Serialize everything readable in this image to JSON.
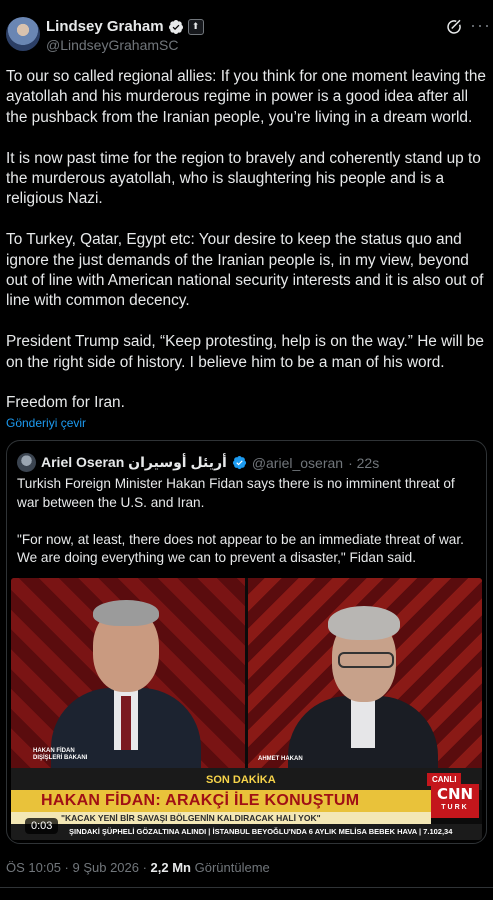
{
  "author": {
    "name": "Lindsey Graham",
    "handle": "@LindseyGrahamSC",
    "affiliation_icon": "government-flag-icon"
  },
  "tweet": {
    "paragraphs": [
      "To our so called regional allies: If you think for one moment leaving the ayatollah and his murderous regime in power is a good idea after all the pushback from the Iranian people, you’re living in a dream world.",
      "It is now past time for the region to bravely and coherently stand up to the murderous ayatollah, who is slaughtering his people and is a religious Nazi.",
      "To Turkey, Qatar, Egypt etc: Your desire to keep the status quo and ignore the just demands of the Iranian people is, in my view, beyond out of line with American national security interests and it is also out of line with common decency.",
      "President Trump said, “Keep protesting, help is on the way.” He will be on the right side of history. I believe him to be a man of his word.",
      "Freedom for Iran."
    ],
    "translate_label": "Gönderiyi çevir"
  },
  "quote": {
    "name": "Ariel Oseran أريئل أوسيران",
    "handle": "@ariel_oseran",
    "time": "· 22s",
    "paragraphs": [
      "Turkish Foreign Minister Hakan Fidan says there is no imminent threat of war between the U.S. and Iran.",
      "\"For now, at least, there does not appear to be an immediate threat of war. We are doing everything we can to prevent a disaster,\" Fidan said."
    ],
    "video": {
      "left_caption_line1": "HAKAN FİDAN",
      "left_caption_line2": "DIŞİŞLERİ BAKANI",
      "right_caption": "AHMET HAKAN",
      "breaking": "SON DAKİKA",
      "live": "CANLI",
      "headline": "HAKAN FİDAN: ARAKÇİ İLE KONUŞTUM",
      "subheadline": "\"KACAK YENİ BİR SAVAŞI BÖLGENİN KALDIRACAK HALİ YOK\"",
      "ticker": "ŞINDAKİ ŞÜPHELİ GÖZALTINA ALINDI  |  İSTANBUL BEYOĞLU'NDA 6 AYLIK MELİSA BEBEK HAVA  |  7.102,34",
      "logo_top": "CNN",
      "logo_bottom": "TURK",
      "timestamp": "0:03"
    }
  },
  "meta": {
    "time": "ÖS 10:05 · 9 Şub 2026 · ",
    "views": "2,2 Mn",
    "views_label": " Görüntüleme"
  },
  "colors": {
    "accent": "#1d9bf0",
    "muted": "#71767b",
    "cnn_red": "#c4161c",
    "headline_yellow": "#e9c23a"
  }
}
